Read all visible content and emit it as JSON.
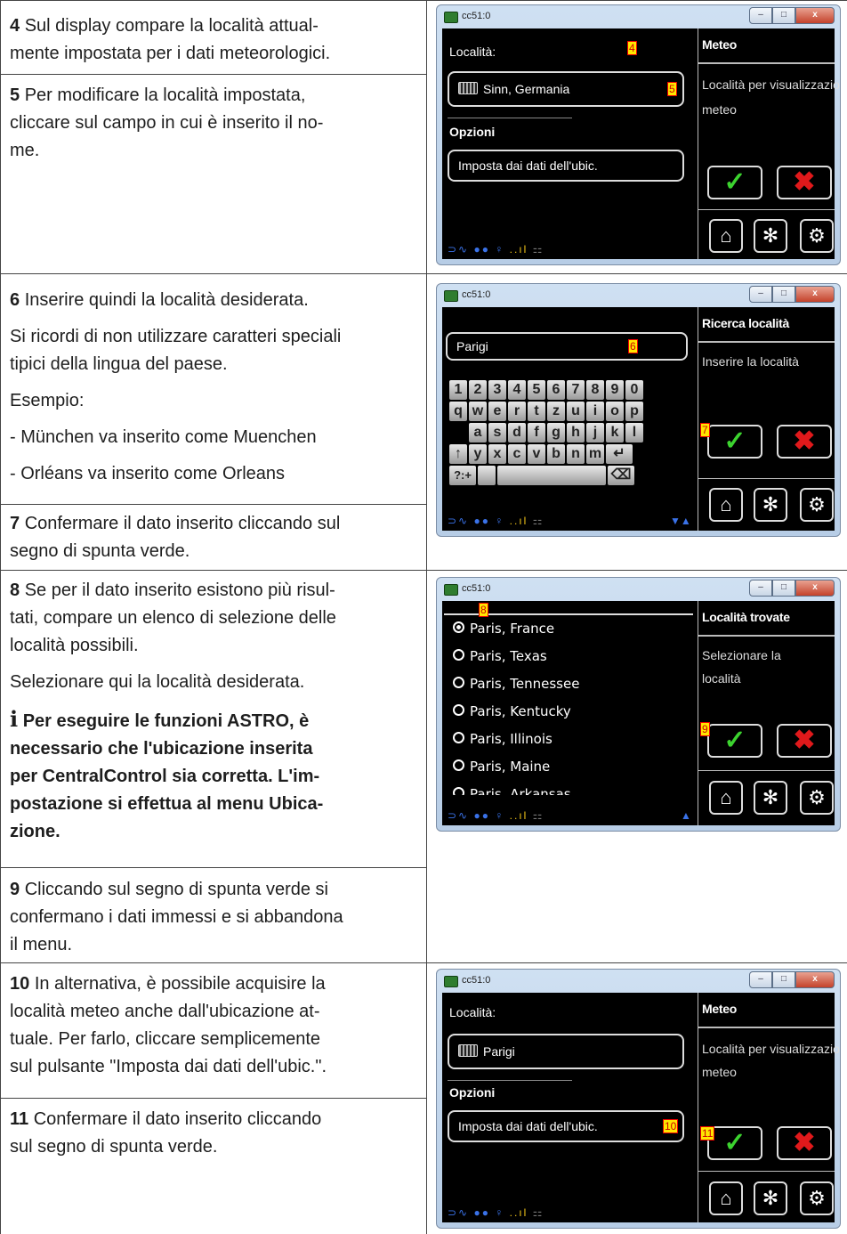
{
  "rows": {
    "r1": {
      "step": "4",
      "text": "Sul display compare la località attual-",
      "text2": "mente impostata per i dati meteorologici."
    },
    "r2": {
      "step": "5",
      "text": "Per modificare la località impostata,",
      "text2": "cliccare sul campo in cui è inserito il no-",
      "text3": "me."
    },
    "r3": {
      "step": "6",
      "text": "Inserire quindi la località desiderata.",
      "p2a": "Si ricordi di non utilizzare caratteri speciali",
      "p2b": "tipici della lingua del paese.",
      "p3": "Esempio:",
      "p4": "- München va inserito come Muenchen",
      "p5": "- Orléans va inserito come Orleans"
    },
    "r4": {
      "step": "7",
      "text": "Confermare il dato inserito cliccando sul",
      "text2": "segno di spunta verde."
    },
    "r5": {
      "step": "8",
      "text": "Se per il dato inserito esistono più risul-",
      "text2": "tati, compare un elenco di selezione delle",
      "text3": "località possibili.",
      "p2": "Selezionare qui la località desiderata.",
      "note_icon": "i",
      "note1": "Per eseguire le funzioni ASTRO, è",
      "note2": "necessario che l'ubicazione inserita",
      "note3": "per CentralControl sia corretta. L'im-",
      "note4": "postazione si effettua al menu Ubica-",
      "note5": "zione."
    },
    "r6": {
      "step": "9",
      "text": "Cliccando sul segno di spunta verde si",
      "text2": "confermano i dati immessi e si abbandona",
      "text3": "il menu."
    },
    "r7": {
      "step": "10",
      "text": "In alternativa, è possibile acquisire la",
      "text2": "località meteo anche dall'ubicazione at-",
      "text3": "tuale. Per farlo, cliccare semplicemente",
      "text4": "sul pulsante \"Imposta dai dati dell'ubic.\"."
    },
    "r8": {
      "step": "11",
      "text": "Confermare il dato inserito cliccando",
      "text2": "sul segno di spunta verde."
    }
  },
  "window": {
    "title": "cc51:0",
    "min": "–",
    "max": "□",
    "close": "x"
  },
  "icons": {
    "ok": "✓",
    "cancel": "✖",
    "home": "home-icon",
    "fan": "fan-icon",
    "gear": "gear-icon",
    "keyboard": "keyboard-icon"
  },
  "shot1": {
    "label_localita": "Località:",
    "field_value": "Sinn, Germania",
    "options_label": "Opzioni",
    "options_button": "Imposta dai dati dell'ubic.",
    "panel_title": "Meteo",
    "panel_text1": "Località per visualizzazio",
    "panel_text2": "meteo",
    "tag_a": "4",
    "tag_b": "5"
  },
  "shot2": {
    "field_value": "Parigi",
    "panel_title": "Ricerca località",
    "panel_text": "Inserire la località",
    "tag_a": "6",
    "tag_b": "7",
    "row1": [
      "1",
      "2",
      "3",
      "4",
      "5",
      "6",
      "7",
      "8",
      "9",
      "0"
    ],
    "row2": [
      "q",
      "w",
      "e",
      "r",
      "t",
      "z",
      "u",
      "i",
      "o",
      "p"
    ],
    "row3": [
      "a",
      "s",
      "d",
      "f",
      "g",
      "h",
      "j",
      "k",
      "l"
    ],
    "row4": [
      "↑",
      "y",
      "x",
      "c",
      "v",
      "b",
      "n",
      "m",
      "↵"
    ],
    "sym": "?:+",
    "bksp": "⌫",
    "scroll": "▼▲"
  },
  "shot3": {
    "items": [
      "Paris, France",
      "Paris, Texas",
      "Paris, Tennessee",
      "Paris, Kentucky",
      "Paris, Illinois",
      "Paris, Maine",
      "Paris, Arkansas"
    ],
    "panel_title": "Località trovate",
    "panel_text1": "Selezionare la",
    "panel_text2": "località",
    "tag_a": "8",
    "tag_b": "9",
    "scroll": "▲"
  },
  "shot4": {
    "label_localita": "Località:",
    "field_value": "Parigi",
    "options_label": "Opzioni",
    "options_button": "Imposta dai dati dell'ubic.",
    "panel_title": "Meteo",
    "panel_text1": "Località per visualizzazio",
    "panel_text2": "meteo",
    "tag_a": "10",
    "tag_b": "11"
  },
  "status": {
    "plug": "⊃∿",
    "link": "●●",
    "bulb": "♀",
    "signal": "..ıl",
    "net": "⚏"
  }
}
